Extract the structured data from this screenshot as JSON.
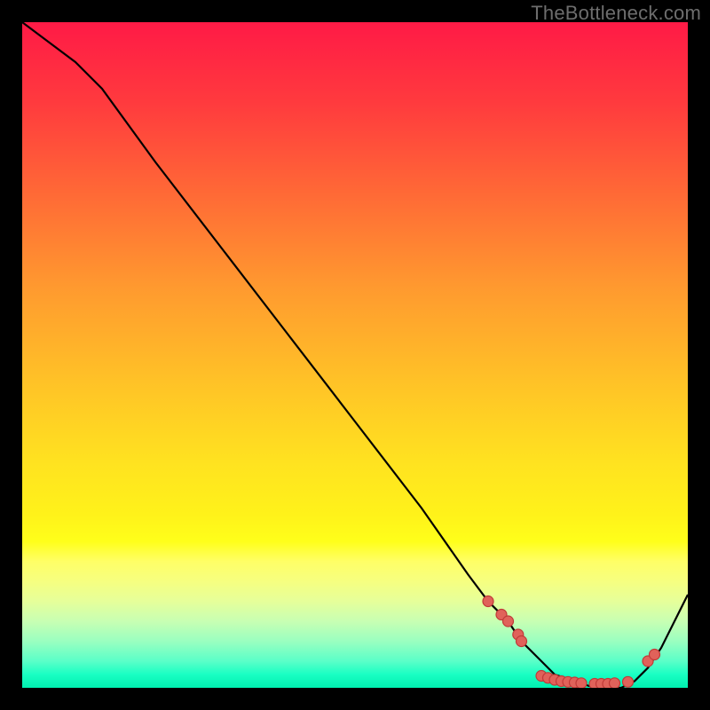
{
  "watermark": "TheBottleneck.com",
  "colors": {
    "bg": "#000000",
    "top_red": "#ff1a46",
    "mid_yellow": "#fff21a",
    "bottom_green": "#00f0b0",
    "marker_fill": "#e0625a",
    "marker_stroke": "#c03a38",
    "line": "#000000"
  },
  "chart_data": {
    "type": "line",
    "title": "",
    "xlabel": "",
    "ylabel": "",
    "xlim": [
      0,
      100
    ],
    "ylim": [
      0,
      100
    ],
    "series": [
      {
        "name": "curve",
        "x": [
          0,
          4,
          8,
          12,
          20,
          30,
          40,
          50,
          60,
          67,
          70,
          73,
          75,
          78,
          80,
          83,
          86,
          88,
          90,
          92,
          94,
          96,
          98,
          100
        ],
        "y": [
          100,
          97,
          94,
          90,
          79,
          66,
          53,
          40,
          27,
          17,
          13,
          10,
          7,
          4,
          2,
          1,
          0,
          0,
          0,
          1,
          3,
          6,
          10,
          14
        ]
      }
    ],
    "markers": {
      "name": "dots",
      "x": [
        70,
        72,
        73,
        74.5,
        75,
        78,
        79,
        80,
        81,
        82,
        83,
        84,
        86,
        87,
        88,
        89,
        91,
        94,
        95
      ],
      "y": [
        13,
        11,
        10,
        8,
        7,
        1.8,
        1.5,
        1.2,
        1.0,
        0.9,
        0.8,
        0.7,
        0.6,
        0.6,
        0.6,
        0.7,
        0.9,
        4,
        5
      ],
      "r": 6
    }
  }
}
